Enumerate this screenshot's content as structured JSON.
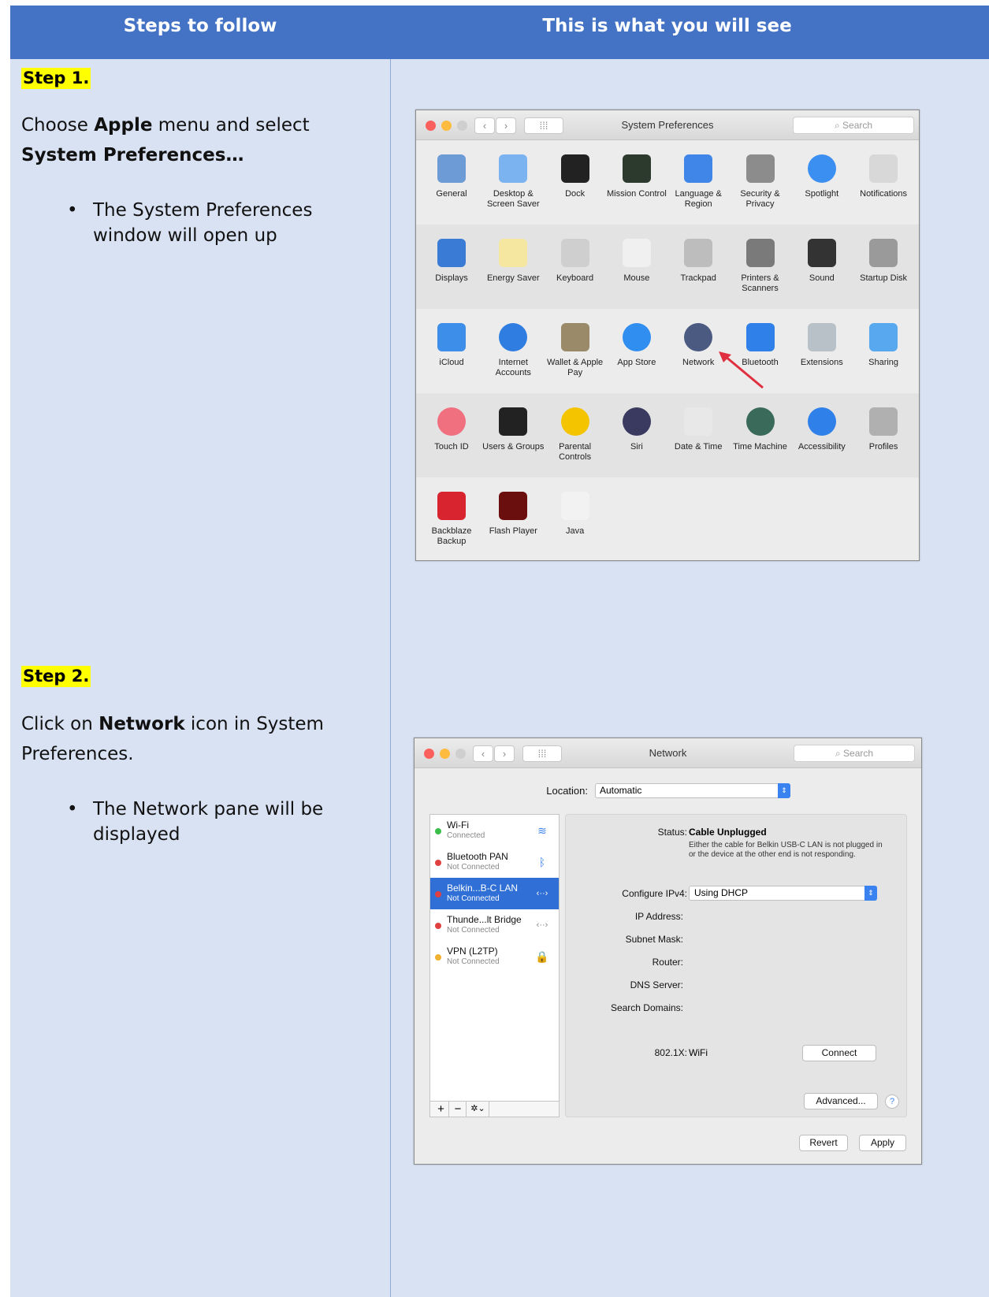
{
  "header": {
    "col1": "Steps to follow",
    "col2": "This is what you will see"
  },
  "step1": {
    "label": "Step 1.",
    "p1": "Choose ",
    "b1": "Apple",
    "p2": " menu and select ",
    "b2": "System Preferences…",
    "bullet": "The System Preferences window will open up"
  },
  "step2": {
    "label": "Step 2.",
    "b1": "Network",
    "p1": " icon in System Preferences.",
    "p0": "Click on ",
    "bullet": "The Network pane will be displayed"
  },
  "syspref": {
    "title": "System Preferences",
    "search_placeholder": "Search",
    "rows": [
      [
        {
          "label": "General",
          "icon": "general-icon",
          "color": "#6d9bd6"
        },
        {
          "label": "Desktop & Screen Saver",
          "icon": "desktop-icon",
          "color": "#7ab3ef"
        },
        {
          "label": "Dock",
          "icon": "dock-icon",
          "color": "#222222"
        },
        {
          "label": "Mission Control",
          "icon": "mission-control-icon",
          "color": "#2c3a2e"
        },
        {
          "label": "Language & Region",
          "icon": "flag-icon",
          "color": "#3f86e8"
        },
        {
          "label": "Security & Privacy",
          "icon": "house-icon",
          "color": "#8c8c8c"
        },
        {
          "label": "Spotlight",
          "icon": "spotlight-icon",
          "color": "#3a8ff0"
        },
        {
          "label": "Notifications",
          "icon": "notifications-icon",
          "color": "#d8d8d8"
        }
      ],
      [
        {
          "label": "Displays",
          "icon": "display-icon",
          "color": "#3a7bd5"
        },
        {
          "label": "Energy Saver",
          "icon": "bulb-icon",
          "color": "#f5e6a0"
        },
        {
          "label": "Keyboard",
          "icon": "keyboard-icon",
          "color": "#cfcfcf"
        },
        {
          "label": "Mouse",
          "icon": "mouse-icon",
          "color": "#f0f0f0"
        },
        {
          "label": "Trackpad",
          "icon": "trackpad-icon",
          "color": "#bdbdbd"
        },
        {
          "label": "Printers & Scanners",
          "icon": "printer-icon",
          "color": "#7a7a7a"
        },
        {
          "label": "Sound",
          "icon": "speaker-icon",
          "color": "#333333"
        },
        {
          "label": "Startup Disk",
          "icon": "disk-icon",
          "color": "#9a9a9a"
        }
      ],
      [
        {
          "label": "iCloud",
          "icon": "icloud-icon",
          "color": "#3d8ee8"
        },
        {
          "label": "Internet Accounts",
          "icon": "at-icon",
          "color": "#2f7de0"
        },
        {
          "label": "Wallet & Apple Pay",
          "icon": "wallet-icon",
          "color": "#9a8a6a"
        },
        {
          "label": "App Store",
          "icon": "appstore-icon",
          "color": "#2f8ef0"
        },
        {
          "label": "Network",
          "icon": "network-globe-icon",
          "color": "#4a5a80"
        },
        {
          "label": "Bluetooth",
          "icon": "bluetooth-icon",
          "color": "#2f80e8"
        },
        {
          "label": "Extensions",
          "icon": "puzzle-icon",
          "color": "#b8c0c8"
        },
        {
          "label": "Sharing",
          "icon": "sharing-icon",
          "color": "#58a8f0"
        }
      ],
      [
        {
          "label": "Touch ID",
          "icon": "fingerprint-icon",
          "color": "#f07080"
        },
        {
          "label": "Users & Groups",
          "icon": "users-icon",
          "color": "#222222"
        },
        {
          "label": "Parental Controls",
          "icon": "parental-icon",
          "color": "#f5c400"
        },
        {
          "label": "Siri",
          "icon": "siri-icon",
          "color": "#3a3a60"
        },
        {
          "label": "Date & Time",
          "icon": "clock-icon",
          "color": "#e8e8e8"
        },
        {
          "label": "Time Machine",
          "icon": "time-machine-icon",
          "color": "#3a6a5a"
        },
        {
          "label": "Accessibility",
          "icon": "accessibility-icon",
          "color": "#2f80e8"
        },
        {
          "label": "Profiles",
          "icon": "profiles-icon",
          "color": "#b0b0b0"
        }
      ],
      [
        {
          "label": "Backblaze Backup",
          "icon": "backblaze-icon",
          "color": "#d8242e"
        },
        {
          "label": "Flash Player",
          "icon": "flash-icon",
          "color": "#6a0e0e"
        },
        {
          "label": "Java",
          "icon": "java-icon",
          "color": "#f2f2f2"
        }
      ]
    ]
  },
  "network": {
    "title": "Network",
    "search_placeholder": "Search",
    "location_label": "Location:",
    "location_value": "Automatic",
    "services": [
      {
        "name": "Wi-Fi",
        "status": "Connected",
        "dot": "#3cbf4a",
        "icon": "wifi-icon"
      },
      {
        "name": "Bluetooth PAN",
        "status": "Not Connected",
        "dot": "#e04040",
        "icon": "bluetooth-icon"
      },
      {
        "name": "Belkin...B-C LAN",
        "status": "Not Connected",
        "dot": "#e04040",
        "icon": "ethernet-icon"
      },
      {
        "name": "Thunde...lt Bridge",
        "status": "Not Connected",
        "dot": "#e04040",
        "icon": "ethernet-icon"
      },
      {
        "name": "VPN (L2TP)",
        "status": "Not Connected",
        "dot": "#f0b030",
        "icon": "lock-icon"
      }
    ],
    "status_label": "Status:",
    "status_value": "Cable Unplugged",
    "status_desc": "Either the cable for Belkin USB-C LAN is not plugged in or the device at the other end is not responding.",
    "configure_label": "Configure IPv4:",
    "configure_value": "Using DHCP",
    "ip_label": "IP Address:",
    "subnet_label": "Subnet Mask:",
    "router_label": "Router:",
    "dns_label": "DNS Server:",
    "search_domains_label": "Search Domains:",
    "x8021_label": "802.1X:",
    "x8021_value": "WiFi",
    "connect": "Connect",
    "advanced": "Advanced...",
    "help": "?",
    "revert": "Revert",
    "apply": "Apply",
    "add": "+",
    "remove": "−"
  }
}
